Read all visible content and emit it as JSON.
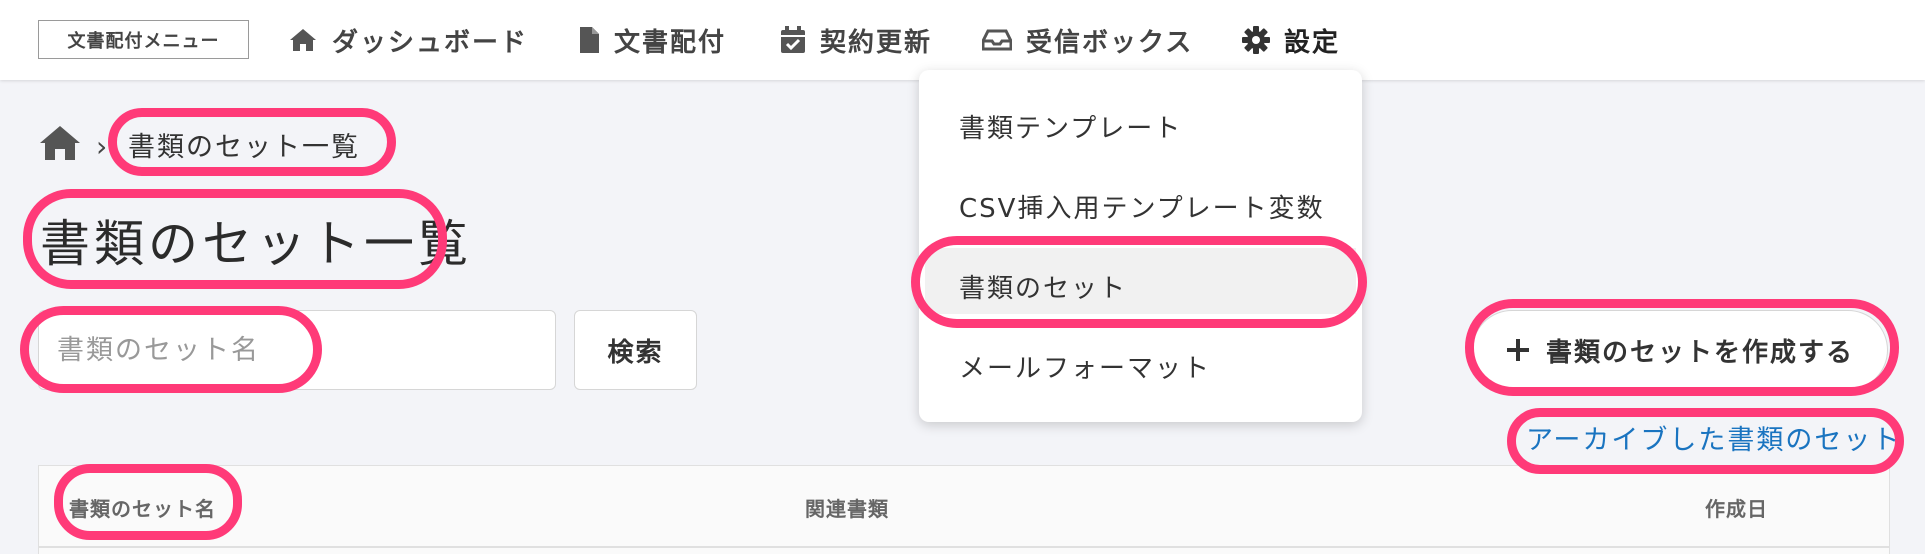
{
  "topbar": {
    "menu_label": "文書配付メニュー",
    "nav": [
      {
        "label": "ダッシュボード",
        "icon": "home-icon"
      },
      {
        "label": "文書配付",
        "icon": "document-icon"
      },
      {
        "label": "契約更新",
        "icon": "calendar-check-icon"
      },
      {
        "label": "受信ボックス",
        "icon": "inbox-icon"
      },
      {
        "label": "設定",
        "icon": "gear-icon"
      }
    ]
  },
  "dropdown": {
    "items": [
      {
        "label": "書類テンプレート"
      },
      {
        "label": "CSV挿入用テンプレート変数"
      },
      {
        "label": "書類のセット",
        "active": true
      },
      {
        "label": "メールフォーマット"
      }
    ]
  },
  "breadcrumb": {
    "home_icon": "home-icon",
    "separator": "›",
    "current": "書類のセット一覧"
  },
  "page": {
    "title": "書類のセット一覧",
    "search_placeholder": "書類のセット名",
    "search_button": "検索",
    "create_button": "書類のセットを作成する",
    "archive_link": "アーカイブした書類のセット"
  },
  "table": {
    "columns": [
      "書類のセット名",
      "関連書類",
      "作成日"
    ]
  },
  "colors": {
    "highlight": "#ff3a78",
    "link": "#1a74c0",
    "background": "#f3f4f8"
  }
}
